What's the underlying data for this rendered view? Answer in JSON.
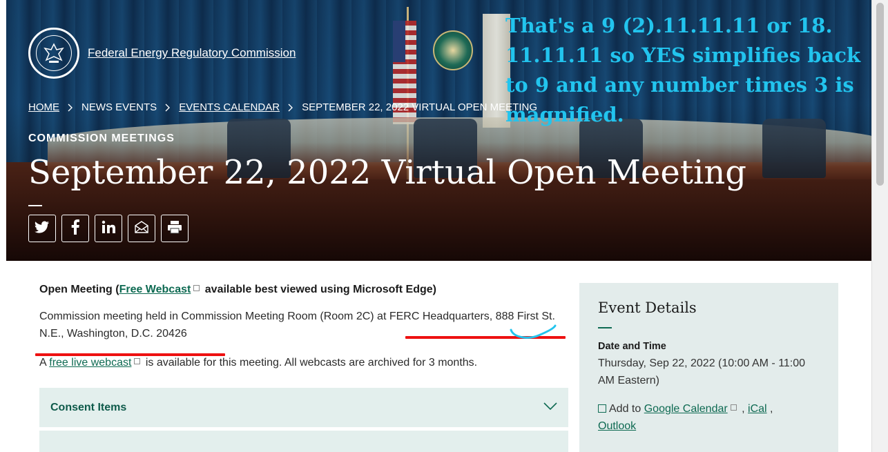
{
  "header": {
    "agency_name": "Federal Energy Regulatory Commission",
    "breadcrumb": [
      {
        "label": "HOME"
      },
      {
        "label": "NEWS EVENTS"
      },
      {
        "label": "EVENTS CALENDAR"
      },
      {
        "label": "SEPTEMBER 22, 2022 VIRTUAL OPEN MEETING"
      }
    ],
    "eyebrow": "COMMISSION MEETINGS",
    "title": "September 22, 2022 Virtual Open Meeting",
    "share_icons": [
      "twitter-icon",
      "facebook-icon",
      "linkedin-icon",
      "email-icon",
      "print-icon"
    ]
  },
  "annotation": {
    "text": "That's a 9 (2).11.11.11 or 18. 11.11.11 so YES simplifies back to 9 and any number times 3 is magnified.",
    "color": "#22c4ee",
    "underline_color": "#e11111"
  },
  "main": {
    "lead_prefix": "Open Meeting (",
    "lead_link": "Free Webcast",
    "lead_suffix": "available best viewed using Microsoft Edge)",
    "paragraph1": "Commission meeting held in Commission Meeting Room (Room 2C) at FERC Headquarters, 888 First St. N.E., Washington, D.C. 20426",
    "paragraph2_prefix": "A",
    "paragraph2_link": "free live webcast",
    "paragraph2_suffix": "is available for this meeting. All webcasts are archived for 3 months.",
    "accordion_label": "Consent Items"
  },
  "sidebar": {
    "heading": "Event Details",
    "date_label": "Date and Time",
    "date_value": "Thursday, Sep 22, 2022 (10:00 AM - 11:00 AM Eastern)",
    "add_to": "Add to",
    "google_link": "Google Calendar",
    "ical_link": "iCal",
    "outlook_link": "Outlook"
  },
  "colors": {
    "accent": "#0e6a52",
    "panel": "#e3eceb"
  }
}
